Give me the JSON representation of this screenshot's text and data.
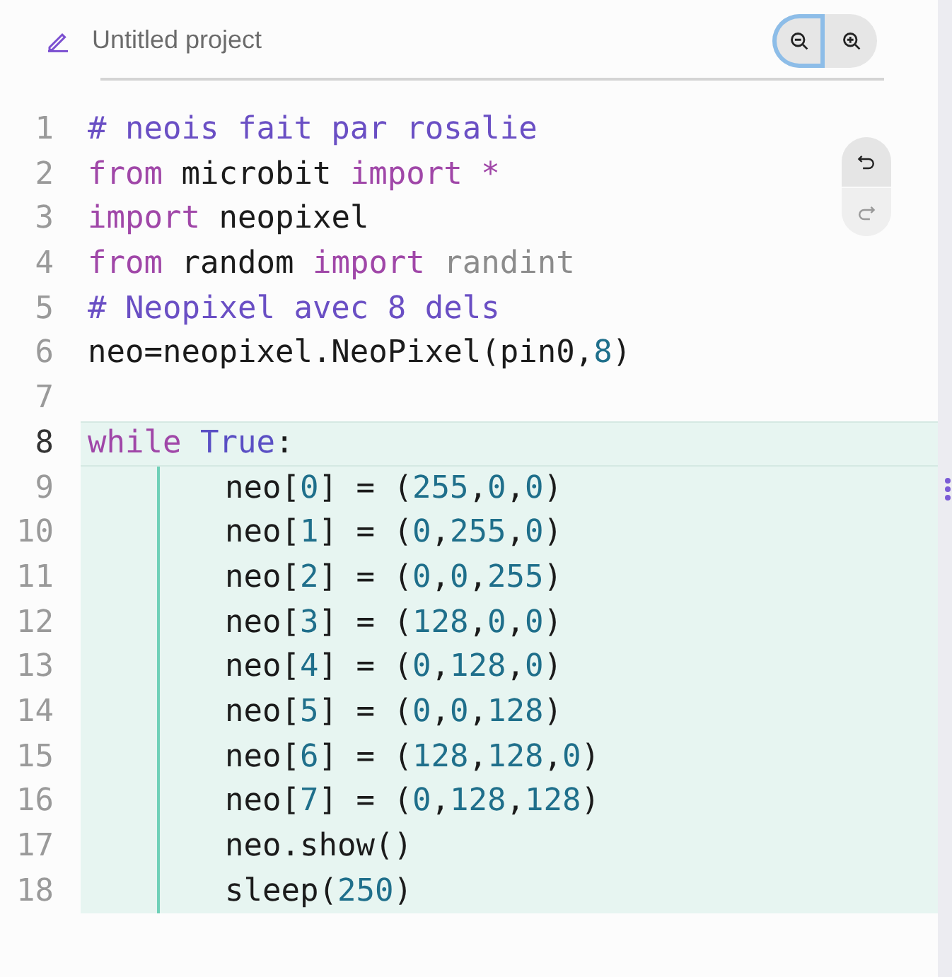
{
  "project": {
    "title": "Untitled project"
  },
  "zoom_buttons": [
    {
      "kind": "zoom-out",
      "focused": true
    },
    {
      "kind": "zoom-in",
      "focused": false
    }
  ],
  "history_buttons": [
    {
      "kind": "undo",
      "disabled": false
    },
    {
      "kind": "redo",
      "disabled": true
    }
  ],
  "code_lines": [
    {
      "number": "1",
      "active": false,
      "tokens": [
        {
          "kind": "comment",
          "text": "# neois fait par rosalie"
        }
      ]
    },
    {
      "number": "2",
      "active": false,
      "tokens": [
        {
          "kind": "keyword",
          "text": "from"
        },
        {
          "kind": "text",
          "text": " microbit "
        },
        {
          "kind": "keyword",
          "text": "import"
        },
        {
          "kind": "keyword",
          "text": " *"
        }
      ]
    },
    {
      "number": "3",
      "active": false,
      "tokens": [
        {
          "kind": "keyword",
          "text": "import"
        },
        {
          "kind": "text",
          "text": " neopixel"
        }
      ]
    },
    {
      "number": "4",
      "active": false,
      "tokens": [
        {
          "kind": "keyword",
          "text": "from"
        },
        {
          "kind": "text",
          "text": " random "
        },
        {
          "kind": "keyword",
          "text": "import"
        },
        {
          "kind": "unused",
          "text": " randint"
        }
      ]
    },
    {
      "number": "5",
      "active": false,
      "tokens": [
        {
          "kind": "comment",
          "text": "# Neopixel avec 8 dels"
        }
      ]
    },
    {
      "number": "6",
      "active": false,
      "tokens": [
        {
          "kind": "text",
          "text": "neo=neopixel.NeoPixel(pin0,"
        },
        {
          "kind": "number",
          "text": "8"
        },
        {
          "kind": "text",
          "text": ")"
        }
      ]
    },
    {
      "number": "7",
      "active": false
    },
    {
      "number": "8",
      "active": true,
      "tokens": [
        {
          "kind": "keyword",
          "text": "while"
        },
        {
          "kind": "constant",
          "text": " True"
        },
        {
          "kind": "text",
          "text": ":"
        }
      ],
      "children": [
        {
          "number": "9",
          "active": false,
          "tokens": [
            {
              "kind": "text",
              "text": "neo["
            },
            {
              "kind": "number",
              "text": "0"
            },
            {
              "kind": "text",
              "text": "] = ("
            },
            {
              "kind": "number",
              "text": "255"
            },
            {
              "kind": "text",
              "text": ","
            },
            {
              "kind": "number",
              "text": "0"
            },
            {
              "kind": "text",
              "text": ","
            },
            {
              "kind": "number",
              "text": "0"
            },
            {
              "kind": "text",
              "text": ")"
            }
          ]
        },
        {
          "number": "10",
          "active": false,
          "tokens": [
            {
              "kind": "text",
              "text": "neo["
            },
            {
              "kind": "number",
              "text": "1"
            },
            {
              "kind": "text",
              "text": "] = ("
            },
            {
              "kind": "number",
              "text": "0"
            },
            {
              "kind": "text",
              "text": ","
            },
            {
              "kind": "number",
              "text": "255"
            },
            {
              "kind": "text",
              "text": ","
            },
            {
              "kind": "number",
              "text": "0"
            },
            {
              "kind": "text",
              "text": ")"
            }
          ]
        },
        {
          "number": "11",
          "active": false,
          "tokens": [
            {
              "kind": "text",
              "text": "neo["
            },
            {
              "kind": "number",
              "text": "2"
            },
            {
              "kind": "text",
              "text": "] = ("
            },
            {
              "kind": "number",
              "text": "0"
            },
            {
              "kind": "text",
              "text": ","
            },
            {
              "kind": "number",
              "text": "0"
            },
            {
              "kind": "text",
              "text": ","
            },
            {
              "kind": "number",
              "text": "255"
            },
            {
              "kind": "text",
              "text": ")"
            }
          ]
        },
        {
          "number": "12",
          "active": false,
          "tokens": [
            {
              "kind": "text",
              "text": "neo["
            },
            {
              "kind": "number",
              "text": "3"
            },
            {
              "kind": "text",
              "text": "] = ("
            },
            {
              "kind": "number",
              "text": "128"
            },
            {
              "kind": "text",
              "text": ","
            },
            {
              "kind": "number",
              "text": "0"
            },
            {
              "kind": "text",
              "text": ","
            },
            {
              "kind": "number",
              "text": "0"
            },
            {
              "kind": "text",
              "text": ")"
            }
          ]
        },
        {
          "number": "13",
          "active": false,
          "tokens": [
            {
              "kind": "text",
              "text": "neo["
            },
            {
              "kind": "number",
              "text": "4"
            },
            {
              "kind": "text",
              "text": "] = ("
            },
            {
              "kind": "number",
              "text": "0"
            },
            {
              "kind": "text",
              "text": ","
            },
            {
              "kind": "number",
              "text": "128"
            },
            {
              "kind": "text",
              "text": ","
            },
            {
              "kind": "number",
              "text": "0"
            },
            {
              "kind": "text",
              "text": ")"
            }
          ]
        },
        {
          "number": "14",
          "active": false,
          "tokens": [
            {
              "kind": "text",
              "text": "neo["
            },
            {
              "kind": "number",
              "text": "5"
            },
            {
              "kind": "text",
              "text": "] = ("
            },
            {
              "kind": "number",
              "text": "0"
            },
            {
              "kind": "text",
              "text": ","
            },
            {
              "kind": "number",
              "text": "0"
            },
            {
              "kind": "text",
              "text": ","
            },
            {
              "kind": "number",
              "text": "128"
            },
            {
              "kind": "text",
              "text": ")"
            }
          ]
        },
        {
          "number": "15",
          "active": false,
          "tokens": [
            {
              "kind": "text",
              "text": "neo["
            },
            {
              "kind": "number",
              "text": "6"
            },
            {
              "kind": "text",
              "text": "] = ("
            },
            {
              "kind": "number",
              "text": "128"
            },
            {
              "kind": "text",
              "text": ","
            },
            {
              "kind": "number",
              "text": "128"
            },
            {
              "kind": "text",
              "text": ","
            },
            {
              "kind": "number",
              "text": "0"
            },
            {
              "kind": "text",
              "text": ")"
            }
          ]
        },
        {
          "number": "16",
          "active": false,
          "tokens": [
            {
              "kind": "text",
              "text": "neo["
            },
            {
              "kind": "number",
              "text": "7"
            },
            {
              "kind": "text",
              "text": "] = ("
            },
            {
              "kind": "number",
              "text": "0"
            },
            {
              "kind": "text",
              "text": ","
            },
            {
              "kind": "number",
              "text": "128"
            },
            {
              "kind": "text",
              "text": ","
            },
            {
              "kind": "number",
              "text": "128"
            },
            {
              "kind": "text",
              "text": ")"
            }
          ]
        },
        {
          "number": "17",
          "active": false,
          "tokens": [
            {
              "kind": "text",
              "text": "neo.show()"
            }
          ]
        },
        {
          "number": "18",
          "active": false,
          "tokens": [
            {
              "kind": "text",
              "text": "sleep("
            },
            {
              "kind": "number",
              "text": "250"
            },
            {
              "kind": "text",
              "text": ")"
            }
          ]
        }
      ]
    }
  ]
}
